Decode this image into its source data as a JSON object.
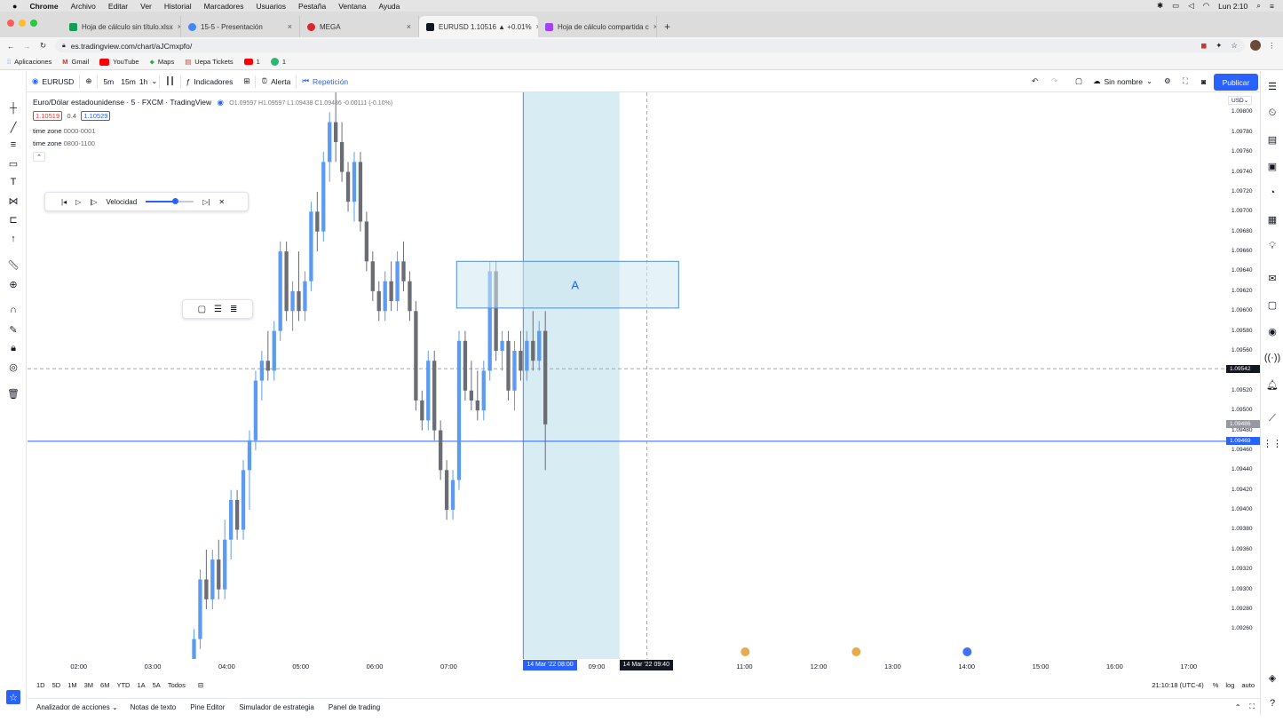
{
  "os_menu": {
    "apple": "",
    "items": [
      "Chrome",
      "Archivo",
      "Editar",
      "Ver",
      "Historial",
      "Marcadores",
      "Usuarios",
      "Pestaña",
      "Ventana",
      "Ayuda"
    ],
    "clock": "Lun 2:10"
  },
  "browser": {
    "tabs": [
      {
        "title": "Hoja de cálculo sin título.xlsx",
        "color": "#0f9d58"
      },
      {
        "title": "15-5 - Presentación",
        "color": "#4285f4"
      },
      {
        "title": "MEGA",
        "color": "#d9272e"
      },
      {
        "title": "EURUSD 1.10516 ▲ +0.01% ",
        "color": "#131722"
      },
      {
        "title": "Hoja de cálculo compartida c",
        "color": "#a142f4"
      }
    ],
    "new_tab": "+",
    "url": "es.tradingview.com/chart/aJCmxpfo/",
    "bookmarks": [
      "Aplicaciones",
      "Gmail",
      "YouTube",
      "Maps",
      "Uepa Tickets",
      "1",
      "1"
    ]
  },
  "toolbar": {
    "symbol": "EURUSD",
    "intervals": [
      "5m",
      "15m",
      "1h"
    ],
    "indicators": "Indicadores",
    "alert": "Alerta",
    "replay": "Repetición",
    "layout_name": "Sin nombre",
    "publish": "Publicar"
  },
  "legend": {
    "title": "Euro/Dólar estadounidense · 5 · FXCM · TradingView",
    "ohlc": "O1.09597 H1.09597 L1.09438 C1.09486 -0.00111 (-0.10%)",
    "bid": "1.10519",
    "spread": "0.4",
    "ask": "1.10529",
    "indicator1_name": "time zone",
    "indicator1_value": "0000-0001",
    "indicator2_name": "time zone",
    "indicator2_value": "0800-1100"
  },
  "replay_panel": {
    "speed_label": "Velocidad",
    "speed": 0.6
  },
  "chart_data": {
    "type": "candlestick",
    "y_ticks": [
      1.098,
      1.0978,
      1.0976,
      1.0974,
      1.0972,
      1.097,
      1.0968,
      1.0966,
      1.0964,
      1.0962,
      1.096,
      1.0958,
      1.0956,
      1.0954,
      1.0952,
      1.095,
      1.0948,
      1.0946,
      1.0944,
      1.0942,
      1.094,
      1.0938,
      1.0936,
      1.0934,
      1.0932,
      1.093,
      1.0928,
      1.0926
    ],
    "y_labels": [
      "1.09800",
      "1.09780",
      "1.09760",
      "1.09740",
      "1.09720",
      "1.09700",
      "1.09680",
      "1.09660",
      "1.09640",
      "1.09620",
      "1.09600",
      "1.09580",
      "1.09560",
      "1.09540",
      "1.09520",
      "1.09500",
      "1.09480",
      "1.09460",
      "1.09440",
      "1.09420",
      "1.09400",
      "1.09380",
      "1.09360",
      "1.09320",
      "1.09300",
      "1.09280",
      "1.09260"
    ],
    "ylim": [
      1.0925,
      1.0982
    ],
    "x_labels": [
      "02:00",
      "03:00",
      "04:00",
      "05:00",
      "06:00",
      "07:00",
      "09:00",
      "11:00",
      "12:00",
      "13:00",
      "14:00",
      "15:00",
      "16:00",
      "17:00"
    ],
    "x_label_hours": [
      2,
      3,
      4,
      5,
      6,
      7,
      9,
      11,
      12,
      13,
      14,
      15,
      16,
      17
    ],
    "xlim_hours": [
      1.3,
      17.5
    ],
    "crosshair_time_label": "14 Mar '22  08:00",
    "cursor_time_label": "14 Mar '22  09:40",
    "current_price_label": "1.09542",
    "last_price_label": "1.09486",
    "horizontal_line_price": 1.09469,
    "horizontal_line_label": "1.09469",
    "session_box": {
      "start_hour": 8.0,
      "end_hour": 9.3
    },
    "rectangle": {
      "start_hour": 7.1,
      "end_hour": 10.1,
      "top": 1.0965,
      "bottom": 1.09603,
      "label": "A"
    },
    "candles_start_hour": 3.55,
    "candle_step_hours": 0.0833,
    "candles": [
      [
        1.0925,
        1.0928,
        1.0924,
        1.0927
      ],
      [
        1.0927,
        1.0934,
        1.0926,
        1.0933
      ],
      [
        1.0933,
        1.0936,
        1.093,
        1.0931
      ],
      [
        1.0931,
        1.0936,
        1.093,
        1.0935
      ],
      [
        1.0935,
        1.0937,
        1.0931,
        1.0932
      ],
      [
        1.0932,
        1.0939,
        1.0931,
        1.0937
      ],
      [
        1.0937,
        1.0942,
        1.0935,
        1.0941
      ],
      [
        1.0941,
        1.0942,
        1.0937,
        1.0938
      ],
      [
        1.0938,
        1.0945,
        1.0937,
        1.0944
      ],
      [
        1.0944,
        1.0948,
        1.094,
        1.0947
      ],
      [
        1.0947,
        1.0954,
        1.0946,
        1.0953
      ],
      [
        1.0953,
        1.0956,
        1.0951,
        1.0955
      ],
      [
        1.0955,
        1.0958,
        1.0953,
        1.0954
      ],
      [
        1.0954,
        1.0959,
        1.0953,
        1.0958
      ],
      [
        1.0958,
        1.0967,
        1.0957,
        1.0966
      ],
      [
        1.0966,
        1.0967,
        1.0959,
        1.096
      ],
      [
        1.096,
        1.0963,
        1.0958,
        1.0962
      ],
      [
        1.0962,
        1.0966,
        1.0959,
        1.096
      ],
      [
        1.096,
        1.0964,
        1.0959,
        1.0963
      ],
      [
        1.0963,
        1.0971,
        1.0962,
        1.097
      ],
      [
        1.097,
        1.0972,
        1.0966,
        1.0968
      ],
      [
        1.0968,
        1.0976,
        1.0967,
        1.0975
      ],
      [
        1.0975,
        1.098,
        1.0973,
        1.0979
      ],
      [
        1.0979,
        1.0982,
        1.0975,
        1.0977
      ],
      [
        1.0977,
        1.0979,
        1.0973,
        1.0974
      ],
      [
        1.0974,
        1.0975,
        1.097,
        1.0971
      ],
      [
        1.0971,
        1.0976,
        1.0969,
        1.0975
      ],
      [
        1.0975,
        1.0976,
        1.0968,
        1.0969
      ],
      [
        1.0969,
        1.097,
        1.0964,
        1.0965
      ],
      [
        1.0965,
        1.0966,
        1.0961,
        1.0962
      ],
      [
        1.0962,
        1.0963,
        1.0959,
        1.096
      ],
      [
        1.096,
        1.0964,
        1.0959,
        1.0963
      ],
      [
        1.0963,
        1.0965,
        1.096,
        1.0961
      ],
      [
        1.0961,
        1.0966,
        1.096,
        1.0965
      ],
      [
        1.0965,
        1.0967,
        1.0962,
        1.0963
      ],
      [
        1.0963,
        1.0964,
        1.0959,
        1.096
      ],
      [
        1.096,
        1.0961,
        1.095,
        1.0951
      ],
      [
        1.0951,
        1.0952,
        1.0948,
        1.0949
      ],
      [
        1.0949,
        1.0956,
        1.0948,
        1.0955
      ],
      [
        1.0955,
        1.0956,
        1.0947,
        1.0948
      ],
      [
        1.0948,
        1.0949,
        1.0943,
        1.0944
      ],
      [
        1.0944,
        1.0945,
        1.0939,
        1.094
      ],
      [
        1.094,
        1.0944,
        1.0939,
        1.0943
      ],
      [
        1.0943,
        1.0958,
        1.0942,
        1.0957
      ],
      [
        1.0957,
        1.0958,
        1.0951,
        1.0952
      ],
      [
        1.0952,
        1.0955,
        1.095,
        1.0951
      ],
      [
        1.0951,
        1.0954,
        1.0949,
        1.095
      ],
      [
        1.095,
        1.0955,
        1.0949,
        1.0954
      ],
      [
        1.0954,
        1.0965,
        1.0953,
        1.0964
      ],
      [
        1.0964,
        1.0965,
        1.0955,
        1.0956
      ],
      [
        1.0956,
        1.0958,
        1.0954,
        1.0957
      ],
      [
        1.0957,
        1.0958,
        1.0951,
        1.0952
      ],
      [
        1.0952,
        1.0957,
        1.095,
        1.0956
      ],
      [
        1.0956,
        1.0958,
        1.0953,
        1.0954
      ],
      [
        1.0954,
        1.0958,
        1.0953,
        1.0957
      ],
      [
        1.0957,
        1.096,
        1.0954,
        1.0955
      ],
      [
        1.0955,
        1.0959,
        1.0954,
        1.0958
      ],
      [
        1.0958,
        1.096,
        1.0944,
        1.09486
      ]
    ],
    "up_color": "#5b9cf2",
    "down_color": "#6b6d75"
  },
  "bottom_ranges": [
    "1D",
    "5D",
    "1M",
    "3M",
    "6M",
    "YTD",
    "1A",
    "5A",
    "Todos"
  ],
  "status": {
    "time": "21:10:18 (UTC-4)",
    "percent": "%",
    "log": "log",
    "auto": "auto"
  },
  "bottom_panels": [
    "Analizador de acciones",
    "Notas de texto",
    "Pine Editor",
    "Simulador de estrategia",
    "Panel de trading"
  ],
  "currency": "USD",
  "colors": {
    "accent": "#2962ff",
    "session_fill": "#d4eaf3",
    "rect_fill": "#cfe7f0",
    "rect_stroke": "#4e8fd6"
  }
}
